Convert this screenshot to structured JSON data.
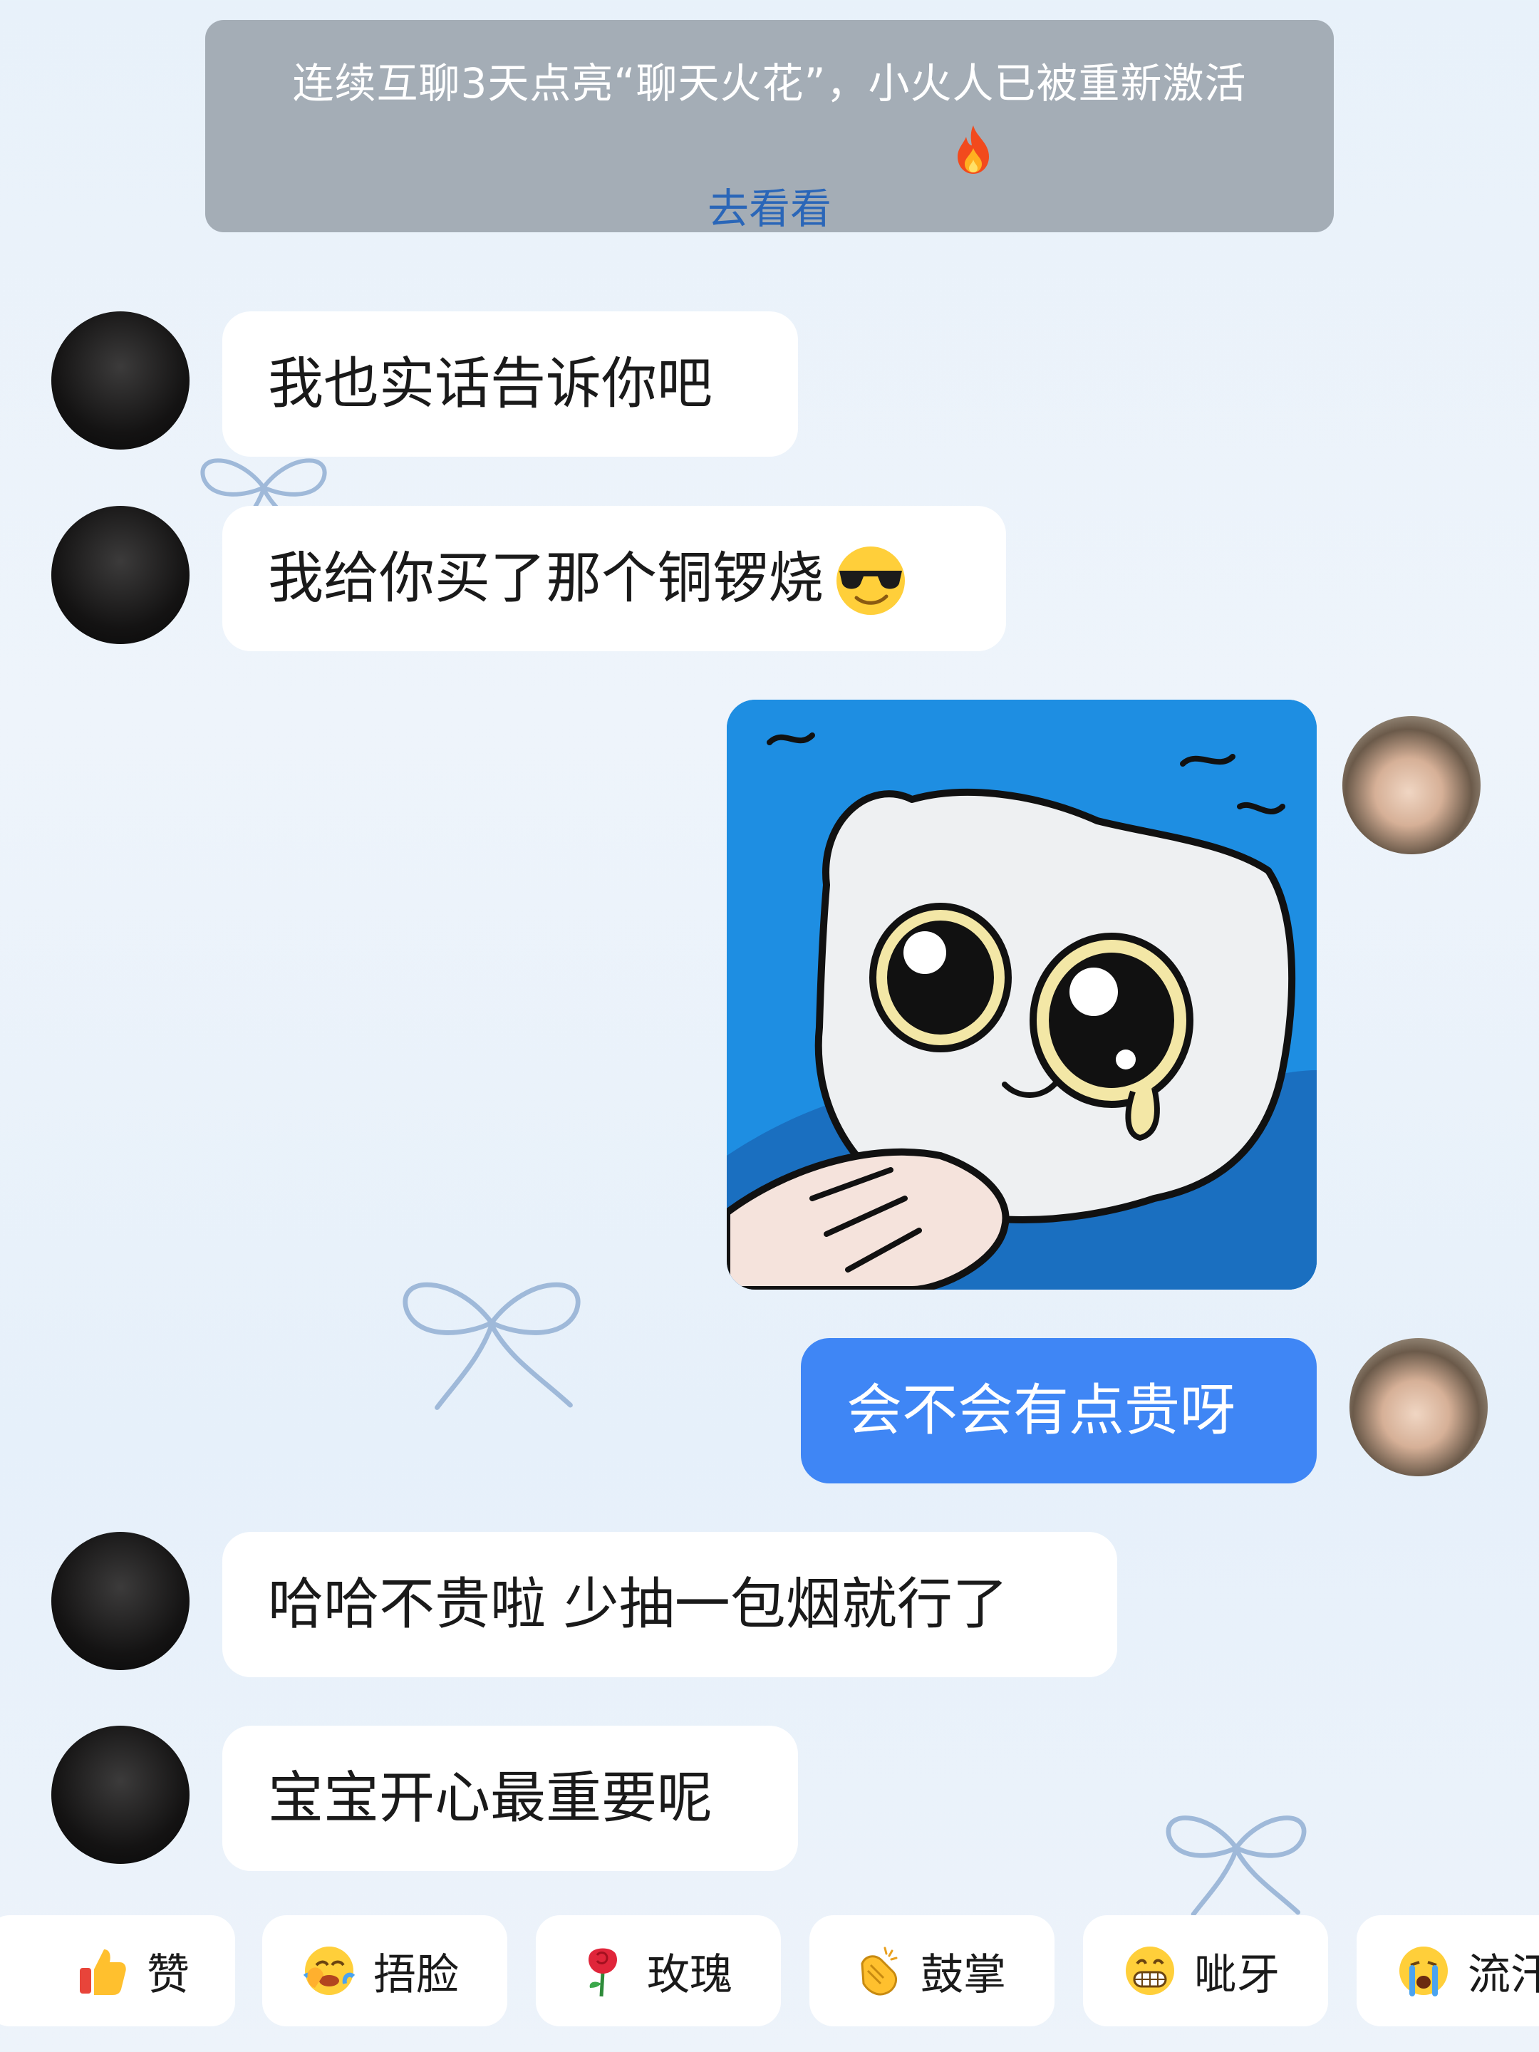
{
  "notice": {
    "text": "连续互聊3天点亮“聊天火花”，小火人已被重新激活",
    "fire_icon": "fire-icon",
    "link_label": "去看看"
  },
  "messages": [
    {
      "side": "received",
      "text": "我也实话告诉你吧"
    },
    {
      "side": "received",
      "text": "我给你买了那个铜锣烧",
      "emoji": "sunglasses-emoji"
    },
    {
      "side": "sent",
      "type": "sticker",
      "sticker": "crying-cat-sticker"
    },
    {
      "side": "sent",
      "text": "会不会有点贵呀"
    },
    {
      "side": "received",
      "text": "哈哈不贵啦 少抽一包烟就行了"
    },
    {
      "side": "received",
      "text": "宝宝开心最重要呢"
    }
  ],
  "quick_replies": [
    {
      "icon": "thumbs-up-icon",
      "label": "赞"
    },
    {
      "icon": "face-palm-icon",
      "label": "捂脸"
    },
    {
      "icon": "rose-icon",
      "label": "玫瑰"
    },
    {
      "icon": "clapping-hands-icon",
      "label": "鼓掌"
    },
    {
      "icon": "grin-icon",
      "label": "呲牙"
    },
    {
      "icon": "crying-face-icon",
      "label": "流汗"
    }
  ],
  "colors": {
    "sent_bubble": "#3f86f5",
    "received_bubble": "#ffffff",
    "notice_bg": "#a4adb6",
    "link": "#2a66b8",
    "sticker_bg": "#1e8ee2"
  }
}
